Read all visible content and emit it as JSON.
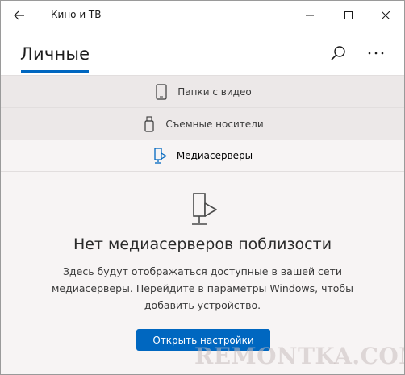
{
  "window": {
    "title": "Кино и ТВ"
  },
  "header": {
    "pivot_label": "Личные"
  },
  "sources": [
    {
      "label": "Папки с видео",
      "icon": "phone-icon"
    },
    {
      "label": "Съемные носители",
      "icon": "usb-drive-icon"
    },
    {
      "label": "Медиасерверы",
      "icon": "media-server-icon"
    }
  ],
  "empty_state": {
    "title": "Нет медиасерверов поблизости",
    "description": "Здесь будут отображаться доступные в вашей сети медиасерверы. Перейдите в параметры Windows, чтобы добавить устройство.",
    "button_label": "Открыть настройки"
  },
  "watermark": "REMONTKA.COM",
  "colors": {
    "accent": "#0067c0",
    "background": "#f7f4f4"
  }
}
